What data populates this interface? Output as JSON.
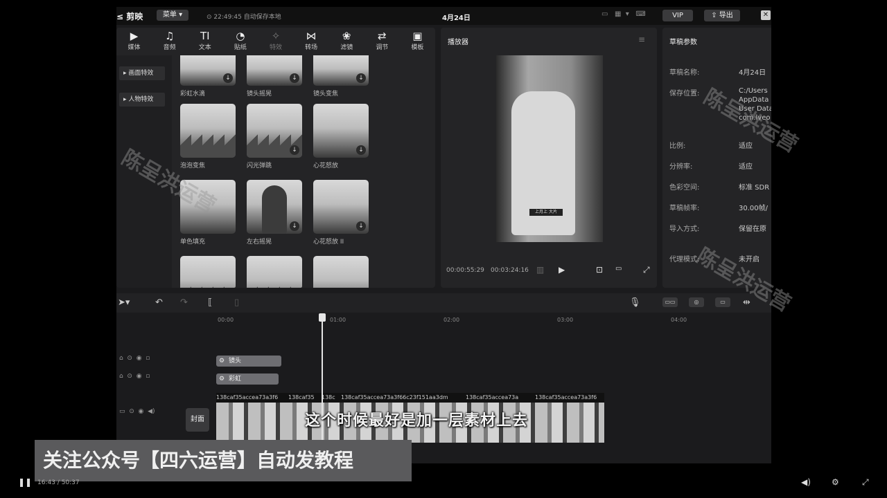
{
  "app": {
    "name": "剪映",
    "menu_label": "菜单",
    "autosave": "22:49:45 自动保存本地",
    "window_title": "4月24日",
    "vip_label": "VIP",
    "export_label": "导出"
  },
  "categories": [
    {
      "icon": "▶",
      "label": "媒体"
    },
    {
      "icon": "♫",
      "label": "音频"
    },
    {
      "icon": "TI",
      "label": "文本"
    },
    {
      "icon": "◔",
      "label": "贴纸"
    },
    {
      "icon": "✧",
      "label": "特效"
    },
    {
      "icon": "⋈",
      "label": "转场"
    },
    {
      "icon": "❀",
      "label": "滤镜"
    },
    {
      "icon": "⇄",
      "label": "调节"
    },
    {
      "icon": "▣",
      "label": "模板"
    }
  ],
  "sidebar": [
    {
      "label": "画面特效"
    },
    {
      "label": "人物特效"
    }
  ],
  "effects": [
    {
      "label": "彩虹水滴"
    },
    {
      "label": "镜头摇晃"
    },
    {
      "label": "镜头变焦"
    },
    {
      "label": "泡泡变焦"
    },
    {
      "label": "闪光弹跳"
    },
    {
      "label": "心花怒放"
    },
    {
      "label": "单色填充"
    },
    {
      "label": "左右摇晃"
    },
    {
      "label": "心花怒放 II"
    },
    {
      "label": ""
    },
    {
      "label": ""
    },
    {
      "label": ""
    }
  ],
  "player": {
    "title": "播放器",
    "video_caption": "上月上 大片",
    "current_time": "00:00:55:29",
    "total_time": "00:03:24:16"
  },
  "draft": {
    "title": "草稿参数",
    "rows": [
      {
        "label": "草稿名称:",
        "value": "4月24日"
      },
      {
        "label": "保存位置:",
        "value": "C:/Users"
      },
      {
        "label": "",
        "value": "AppData"
      },
      {
        "label": "",
        "value": "User Data"
      },
      {
        "label": "",
        "value": "com.lveo"
      },
      {
        "label": "比例:",
        "value": "适应"
      },
      {
        "label": "分辨率:",
        "value": "适应"
      },
      {
        "label": "色彩空间:",
        "value": "标准 SDR"
      },
      {
        "label": "草稿帧率:",
        "value": "30.00帧/"
      },
      {
        "label": "导入方式:",
        "value": "保留在原"
      },
      {
        "label": "代理模式:",
        "value": "未开启"
      }
    ]
  },
  "timeline": {
    "ruler": [
      "00:00",
      "01:00",
      "02:00",
      "03:00",
      "04:00"
    ],
    "effect_chips": [
      "镜头",
      "彩虹"
    ],
    "cover_label": "封面",
    "clip_names": [
      "138caf35accea73a3f6",
      "138caf35",
      "138c",
      "138caf35accea73a3f66c23f151aa3dm",
      "138caf35accea73a",
      "138caf35accea73a3f6"
    ]
  },
  "overlay": {
    "subtitle": "这个时候最好是加一层素材上去",
    "banner": "关注公众号【四六运营】自动发教程",
    "watermark": "陈呈洪运营"
  },
  "bottombar": {
    "time": "16:43 / 50:37"
  }
}
